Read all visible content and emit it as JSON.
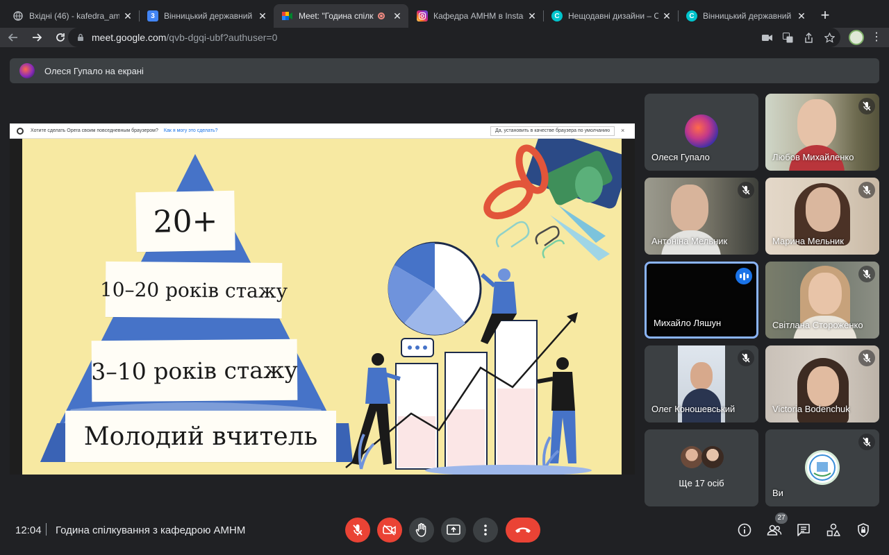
{
  "browser": {
    "tabs": [
      {
        "title": "Вхідні (46) - kafedra_amnm",
        "favicon": "globe-icon",
        "active": false
      },
      {
        "title": "Вінницький державний пе",
        "favicon": "calendar-3-icon",
        "active": false
      },
      {
        "title": "Meet: \"Година спілкув",
        "favicon": "meet-icon",
        "active": true,
        "recording": true
      },
      {
        "title": "Кафедра АМНМ в Instagra",
        "favicon": "instagram-icon",
        "active": false
      },
      {
        "title": "Нещодавні дизайни – Can",
        "favicon": "canva-icon",
        "active": false
      },
      {
        "title": "Вінницький державний – В",
        "favicon": "canva-icon",
        "active": false
      }
    ],
    "url_host": "meet.google.com",
    "url_path": "/qvb-dgqi-ubf?authuser=0"
  },
  "presenting": {
    "text": "Олеся Гупало на екрані"
  },
  "opera_bar": {
    "prompt": "Хотите сделать Opera своим повседневным браузером?",
    "link": "Как я могу это сделать?",
    "button": "Да, установить в качестве браузера по умолчанию",
    "close": "×"
  },
  "slide": {
    "tier1": "20+",
    "tier2": "10–20 років стажу",
    "tier3": "3–10 років стажу",
    "tier4": "Молодий вчитель",
    "colors": {
      "background": "#f7e9a2",
      "blue": "#4673c8",
      "red": "#e2553a",
      "green": "#4fa86a"
    }
  },
  "participants": [
    {
      "name": "Олеся Гупало",
      "muted": false
    },
    {
      "name": "Любов Михайленко",
      "muted": true
    },
    {
      "name": "Антоніна Мельник",
      "muted": true
    },
    {
      "name": "Марина Мельник",
      "muted": true
    },
    {
      "name": "Михайло Ляшун",
      "muted": false,
      "speaking": true
    },
    {
      "name": "Світлана Стороженко",
      "muted": true
    },
    {
      "name": "Олег Коношевський",
      "muted": true
    },
    {
      "name": "Victoria Bodenchuk",
      "muted": true
    },
    {
      "name": "Ще 17 осіб",
      "muted": false
    },
    {
      "name": "Ви",
      "muted": true
    }
  ],
  "bottom": {
    "time": "12:04",
    "meeting_title": "Година спілкування з кафедрою АМНМ",
    "people_count": "27"
  },
  "colors": {
    "meet_bg": "#202124",
    "tile_bg": "#3c4043",
    "danger": "#ea4335",
    "accent": "#8ab4f8"
  }
}
